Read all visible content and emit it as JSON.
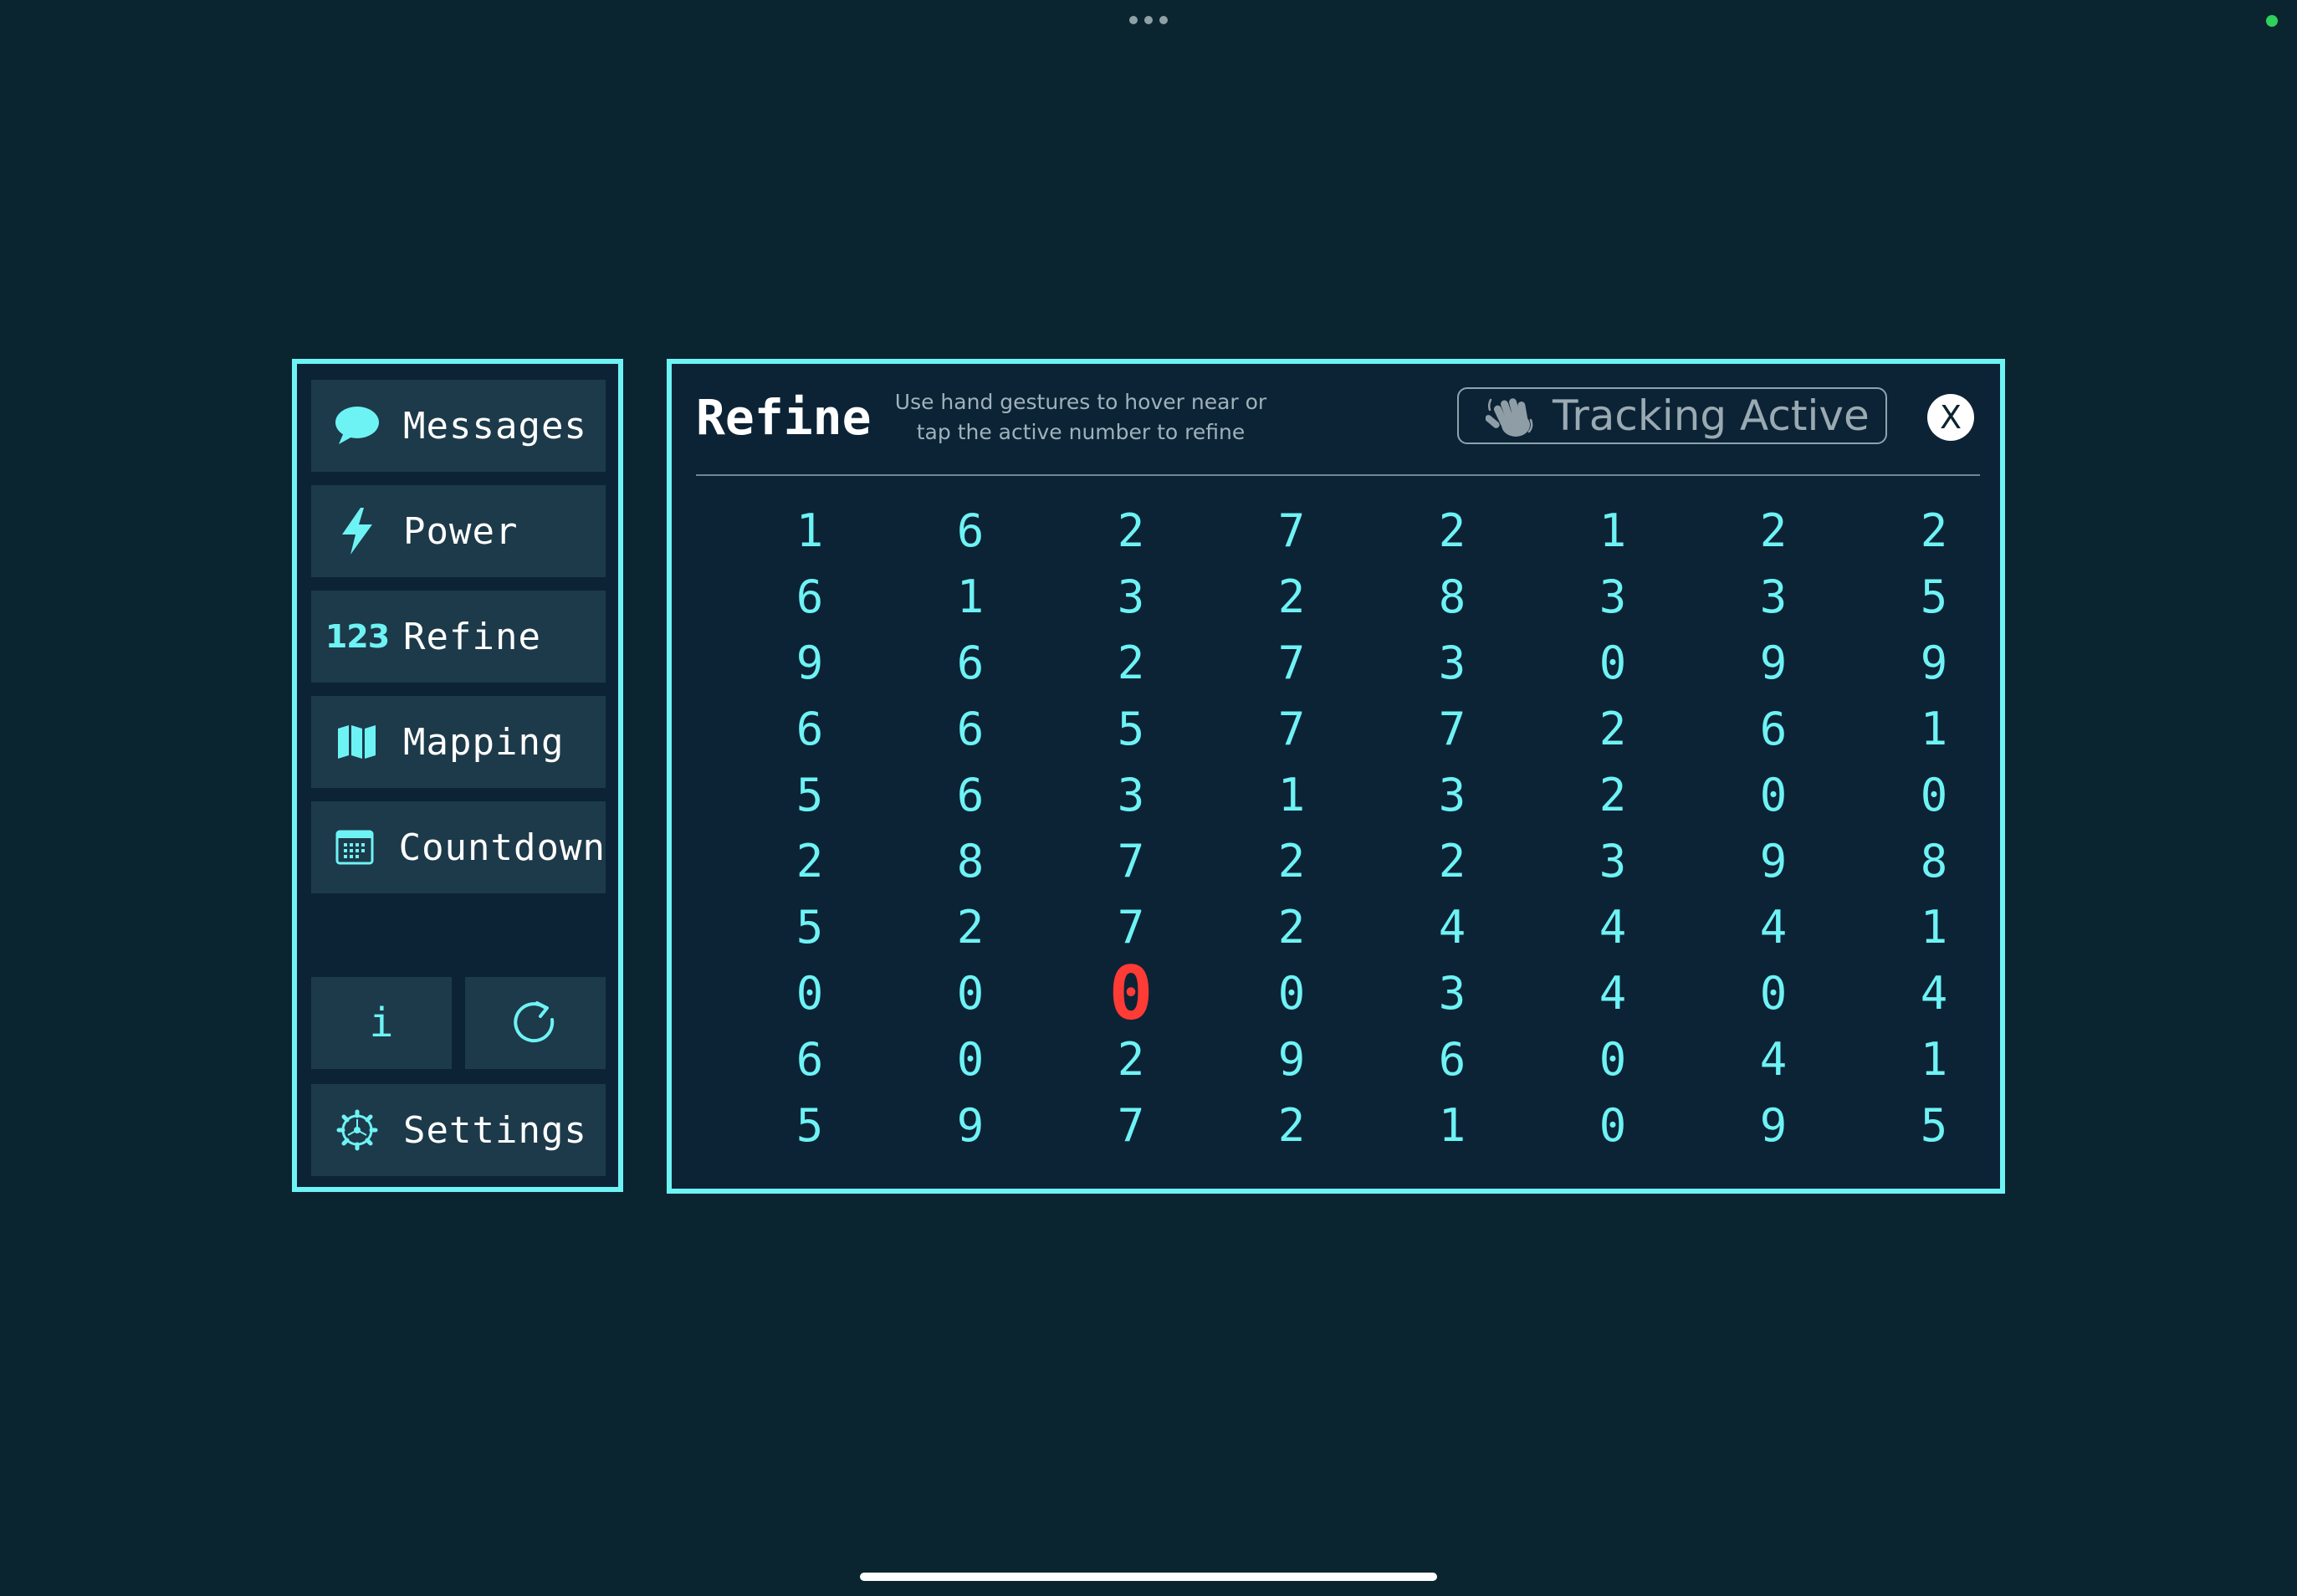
{
  "sidebar": {
    "items": [
      {
        "label": "Messages",
        "icon": "speech-bubble-icon"
      },
      {
        "label": "Power",
        "icon": "lightning-bolt-icon"
      },
      {
        "label": "Refine",
        "icon": "numbers-123-icon",
        "icon_text": "123"
      },
      {
        "label": "Mapping",
        "icon": "map-icon"
      },
      {
        "label": "Countdown",
        "icon": "calendar-icon"
      }
    ],
    "info_label": "i",
    "settings_label": "Settings"
  },
  "panel": {
    "title": "Refine",
    "instruction": "Use hand gestures to hover near or tap the active number to refine",
    "tracking_label": "Tracking Active",
    "close_label": "X"
  },
  "grid": {
    "columns": 8,
    "rows": [
      [
        "1",
        "6",
        "2",
        "7",
        "2",
        "1",
        "2",
        "2"
      ],
      [
        "6",
        "1",
        "3",
        "2",
        "8",
        "3",
        "3",
        "5"
      ],
      [
        "9",
        "6",
        "2",
        "7",
        "3",
        "0",
        "9",
        "9"
      ],
      [
        "6",
        "6",
        "5",
        "7",
        "7",
        "2",
        "6",
        "1"
      ],
      [
        "5",
        "6",
        "3",
        "1",
        "3",
        "2",
        "0",
        "0"
      ],
      [
        "2",
        "8",
        "7",
        "2",
        "2",
        "3",
        "9",
        "8"
      ],
      [
        "5",
        "2",
        "7",
        "2",
        "4",
        "4",
        "4",
        "1"
      ],
      [
        "0",
        "0",
        "0",
        "0",
        "3",
        "4",
        "0",
        "4"
      ],
      [
        "6",
        "0",
        "2",
        "9",
        "6",
        "0",
        "4",
        "1"
      ],
      [
        "5",
        "9",
        "7",
        "2",
        "1",
        "0",
        "9",
        "5"
      ]
    ],
    "active_cell": {
      "row": 8,
      "column": 3
    }
  },
  "colors": {
    "background": "#0b2530",
    "accent": "#6ef3f5",
    "active_number": "#ff3b36",
    "panel_background": "#0c2336",
    "button_background": "#1d3a4a"
  }
}
